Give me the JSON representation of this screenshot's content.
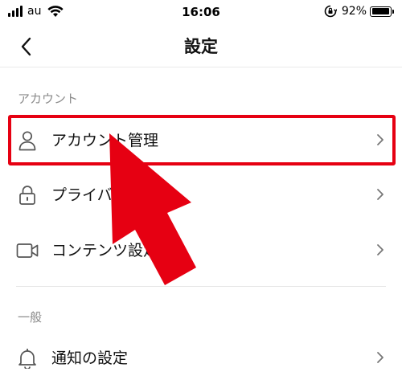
{
  "status_bar": {
    "carrier": "au",
    "time": "16:06",
    "battery_percent": "92%",
    "battery_level": 0.92,
    "signal_bars": 4
  },
  "header": {
    "title": "設定",
    "back_icon": "chevron-left-icon"
  },
  "sections": [
    {
      "title": "アカウント",
      "items": [
        {
          "label": "アカウント管理",
          "icon": "person-icon"
        },
        {
          "label": "プライバシー設定",
          "icon": "lock-icon"
        },
        {
          "label": "コンテンツ設定",
          "icon": "video-camera-icon"
        }
      ]
    },
    {
      "title": "一般",
      "items": [
        {
          "label": "通知の設定",
          "icon": "bell-icon"
        }
      ]
    }
  ],
  "annotation": {
    "highlight_color": "#e60012",
    "highlighted_item": "アカウント管理"
  }
}
